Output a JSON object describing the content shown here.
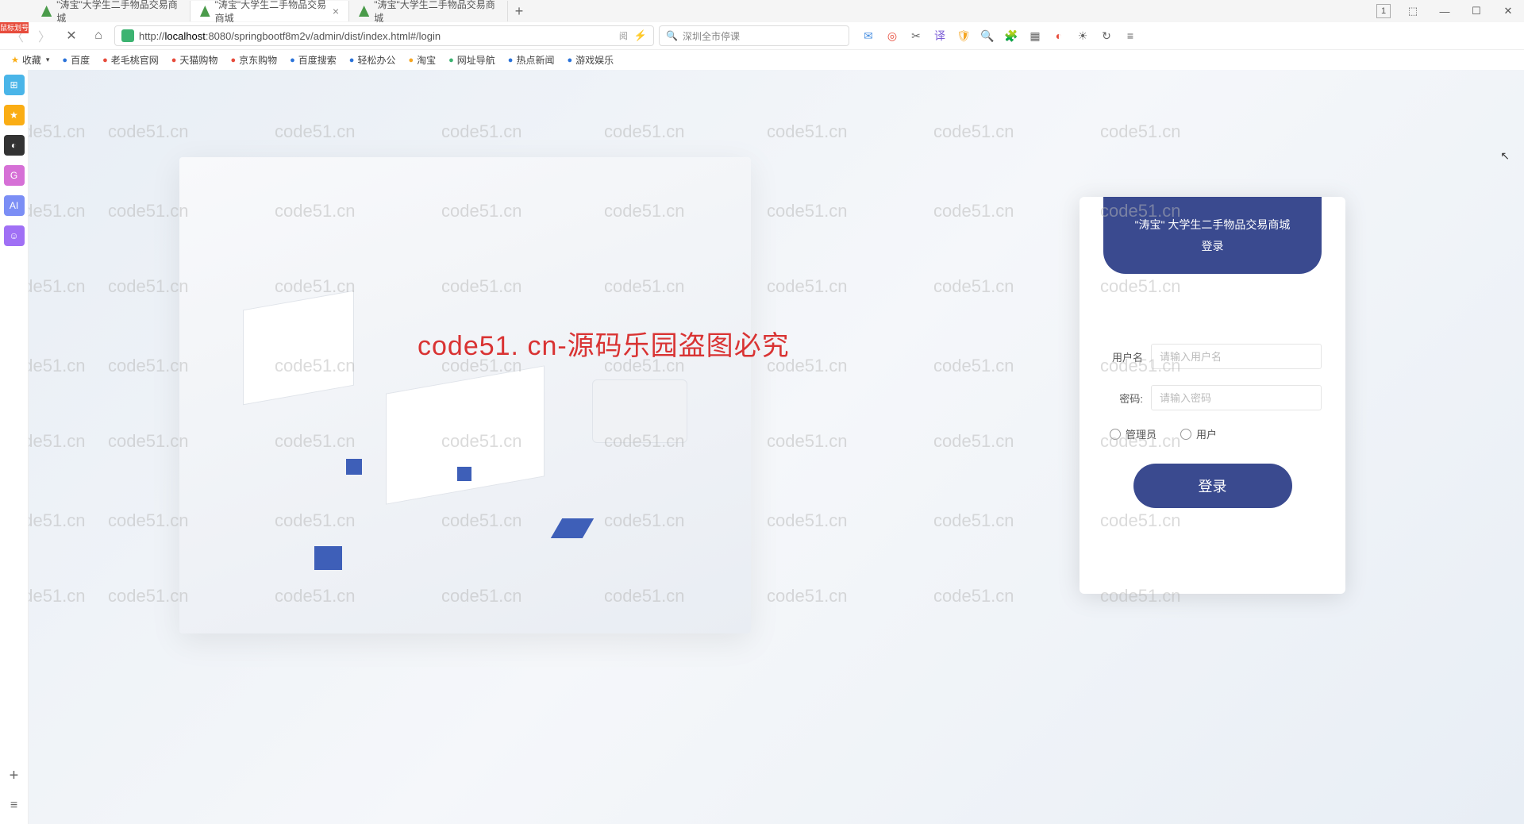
{
  "tabs": [
    {
      "title": "\"涛宝\"大学生二手物品交易商城"
    },
    {
      "title": "\"涛宝\"大学生二手物品交易商城"
    },
    {
      "title": "\"涛宝\"大学生二手物品交易商城"
    }
  ],
  "tab_add": "+",
  "window_controls": {
    "badge": "1",
    "min": "—",
    "max": "☐",
    "close": "✕",
    "extra": "⬚"
  },
  "addr": {
    "url_prefix": "http://",
    "url_host": "localhost",
    "url_rest": ":8080/springbootf8m2v/admin/dist/index.html#/login",
    "reader": "阅",
    "flash": "⚡"
  },
  "search": {
    "icon": "🔍",
    "text": "深圳全市停课"
  },
  "toolbar_icons": [
    "✉",
    "◎",
    "✂",
    "译",
    "🛡",
    "🔍",
    "🧩",
    "▦",
    "◐",
    "☀",
    "↻",
    "≡"
  ],
  "toolbar_colors": [
    "#4a90e2",
    "#e74c3c",
    "#666",
    "#7b5cd6",
    "#f5a623",
    "#4a90e2",
    "#666",
    "#666",
    "#e74c3c",
    "#666",
    "#666",
    "#666"
  ],
  "bookmarks": [
    {
      "label": "收藏",
      "color": "#faad14",
      "icon": "★"
    },
    {
      "label": "百度",
      "color": "#2b73d9",
      "icon": "●"
    },
    {
      "label": "老毛桃官网",
      "color": "#e74c3c",
      "icon": "●"
    },
    {
      "label": "天猫购物",
      "color": "#e74c3c",
      "icon": "●"
    },
    {
      "label": "京东购物",
      "color": "#e74c3c",
      "icon": "●"
    },
    {
      "label": "百度搜索",
      "color": "#2b73d9",
      "icon": "●"
    },
    {
      "label": "轻松办公",
      "color": "#2b73d9",
      "icon": "●"
    },
    {
      "label": "淘宝",
      "color": "#f5a623",
      "icon": "●"
    },
    {
      "label": "网址导航",
      "color": "#3cb371",
      "icon": "●"
    },
    {
      "label": "热点新闻",
      "color": "#2b73d9",
      "icon": "●"
    },
    {
      "label": "游戏娱乐",
      "color": "#2b73d9",
      "icon": "●"
    }
  ],
  "bookmark_arrow": "▾",
  "sidebar_icons": [
    {
      "glyph": "⊞",
      "bg": "#4ab5e8"
    },
    {
      "glyph": "★",
      "bg": "#faad14"
    },
    {
      "glyph": "◐",
      "bg": "#333"
    },
    {
      "glyph": "G",
      "bg": "#d670d6"
    },
    {
      "glyph": "AI",
      "bg": "#7b8ef5"
    },
    {
      "glyph": "☺",
      "bg": "#a070f5"
    }
  ],
  "sidebar_bottom": {
    "plus": "+",
    "menu": "≡"
  },
  "corner_badge": "鼠标划号",
  "login": {
    "title_line1": "\"涛宝\" 大学生二手物品交易商城",
    "title_line2": "登录",
    "username_label": "用户名",
    "username_placeholder": "请输入用户名",
    "password_label": "密码:",
    "password_placeholder": "请输入密码",
    "role_admin": "管理员",
    "role_user": "用户",
    "submit": "登录"
  },
  "watermark_text": "code51.cn",
  "watermark_red": "code51. cn-源码乐园盗图必究"
}
